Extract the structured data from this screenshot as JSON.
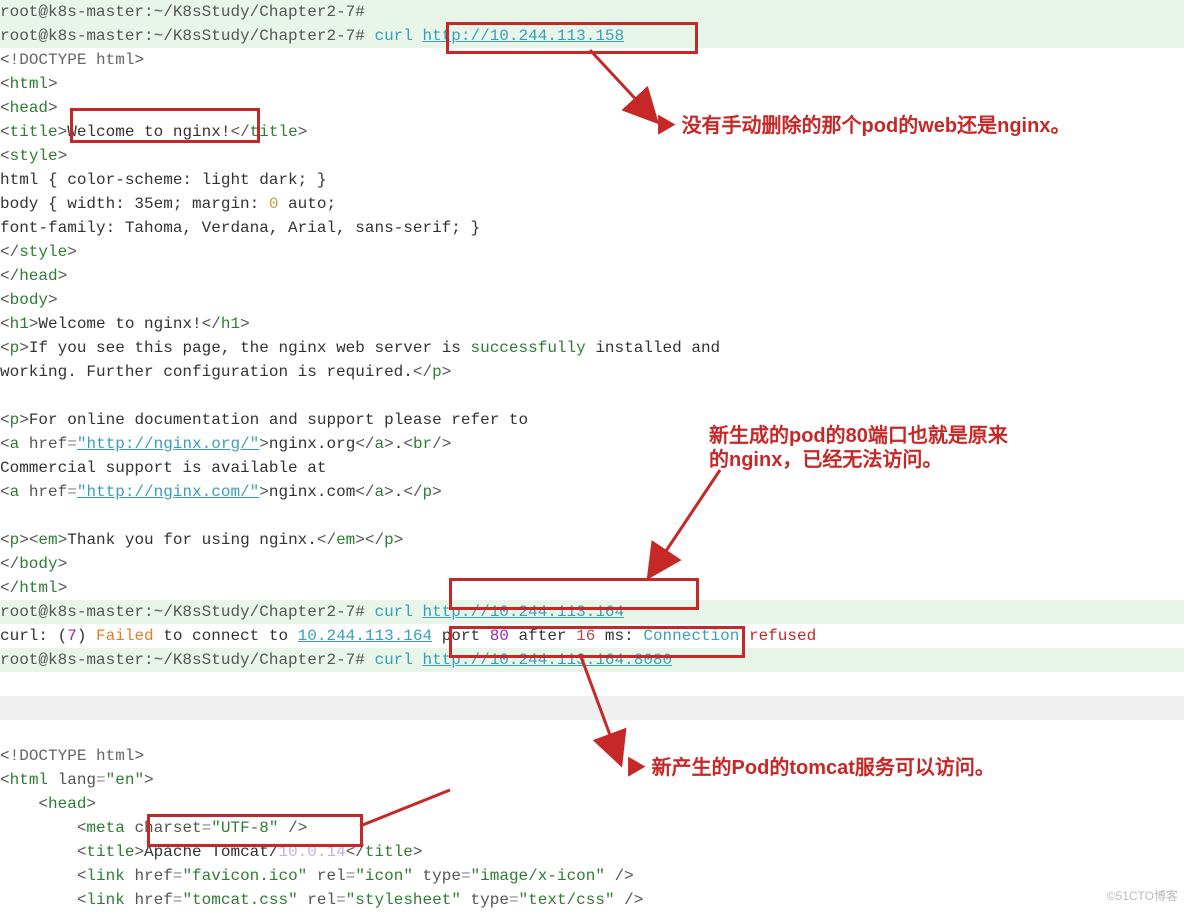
{
  "term": {
    "prompt": "root@k8s-master:~/K8sStudy/Chapter2-7#",
    "cmd_curl": "curl",
    "url1": "http://10.244.113.158",
    "url2": "http://10.244.113.164",
    "url3": "http://10.244.113.164:8080",
    "curl_label": "curl",
    "colon": ":",
    "err_open": " (",
    "err_code": "7",
    "err_close": ") ",
    "failed": "Failed",
    "connect_to": " to connect to ",
    "ip_fail": "10.244.113.164",
    "port_txt": " port ",
    "port_num": "80",
    "after_txt": " after ",
    "ms_num": "16",
    "ms_txt": " ms",
    "colon2": ": ",
    "conn_txt": "Connection ",
    "refused": "refused"
  },
  "html1": {
    "doctype": "!DOCTYPE html",
    "html": "html",
    "head": "head",
    "title": "title",
    "title_text": "Welcome to nginx!",
    "style": "style",
    "css1": "html { color-scheme: light dark; }",
    "css2_a": "body { width",
    "css2_b": "35em",
    "css2_c": "; margin",
    "css2_d": "0",
    "css2_e": " auto;",
    "css3": "font-family: Tahoma, Verdana, Arial, sans-serif; }",
    "body": "body",
    "h1": "h1",
    "h1_text": "Welcome to nginx!",
    "p": "p",
    "p1a": "If you see this page, the nginx web server is ",
    "p1b": "successfully",
    "p1c": " installed and",
    "p2": "working. Further configuration is required.",
    "p3": "For online documentation and support please refer to",
    "a": "a",
    "href": "href",
    "href1": "\"http://nginx.org/\"",
    "a1_text": "nginx.org",
    "br": "br",
    "comm": "Commercial support is available at",
    "href2": "\"http://nginx.com/\"",
    "a2_text": "nginx.com",
    "em": "em",
    "em_text": "Thank you for using nginx."
  },
  "html2": {
    "doctype": "!DOCTYPE html",
    "html": "html",
    "lang_attr": "lang",
    "lang_val": "\"en\"",
    "head": "head",
    "meta": "meta",
    "charset_attr": "charset",
    "charset_val": "\"UTF-8\"",
    "slash": " /",
    "title": "title",
    "title_text": "Apache Tomcat/",
    "title_ver": "10.0.14",
    "link": "link",
    "href_attr": "href",
    "rel_attr": "rel",
    "type_attr": "type",
    "favicon": "\"favicon.ico\"",
    "icon": "\"icon\"",
    "xicon": "\"image/x-icon\"",
    "tomcatcss": "\"tomcat.css\"",
    "stylesheet": "\"stylesheet\"",
    "textcss": "\"text/css\""
  },
  "anno": {
    "a1": "没有手动删除的那个pod的web还是nginx。",
    "a2a": "新生成的pod的80端口也就是原来",
    "a2b": "的nginx，已经无法访问。",
    "a3": "新产生的Pod的tomcat服务可以访问。"
  },
  "watermark": "©51CTO博客"
}
